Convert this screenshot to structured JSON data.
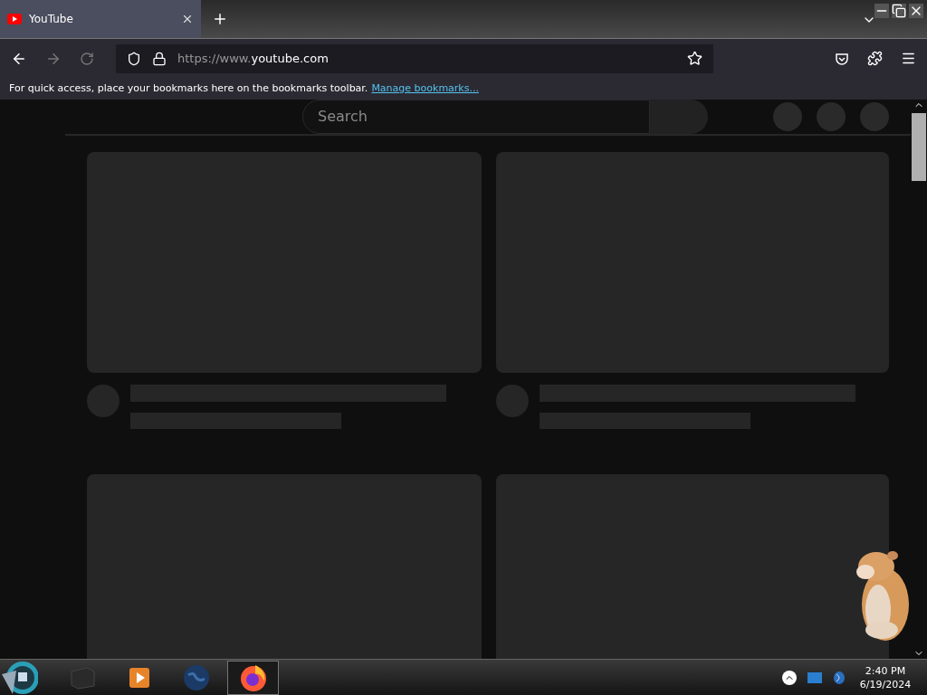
{
  "browser": {
    "tabs": [
      {
        "title": "YouTube",
        "selected": true
      }
    ],
    "address": {
      "scheme": "https://www.",
      "domain": "youtube.com"
    },
    "bookmarks_bar": {
      "message": "For quick access, place your bookmarks here on the bookmarks toolbar.",
      "link": "Manage bookmarks..."
    }
  },
  "page": {
    "search": {
      "placeholder": "Search"
    }
  },
  "taskbar": {
    "apps": [
      {
        "kind": "folder",
        "selected": false
      },
      {
        "kind": "media",
        "selected": false
      },
      {
        "kind": "globe",
        "selected": false
      },
      {
        "kind": "firefox",
        "selected": true
      }
    ],
    "clock": {
      "time": "2:40 PM",
      "date": "6/19/2024"
    }
  }
}
